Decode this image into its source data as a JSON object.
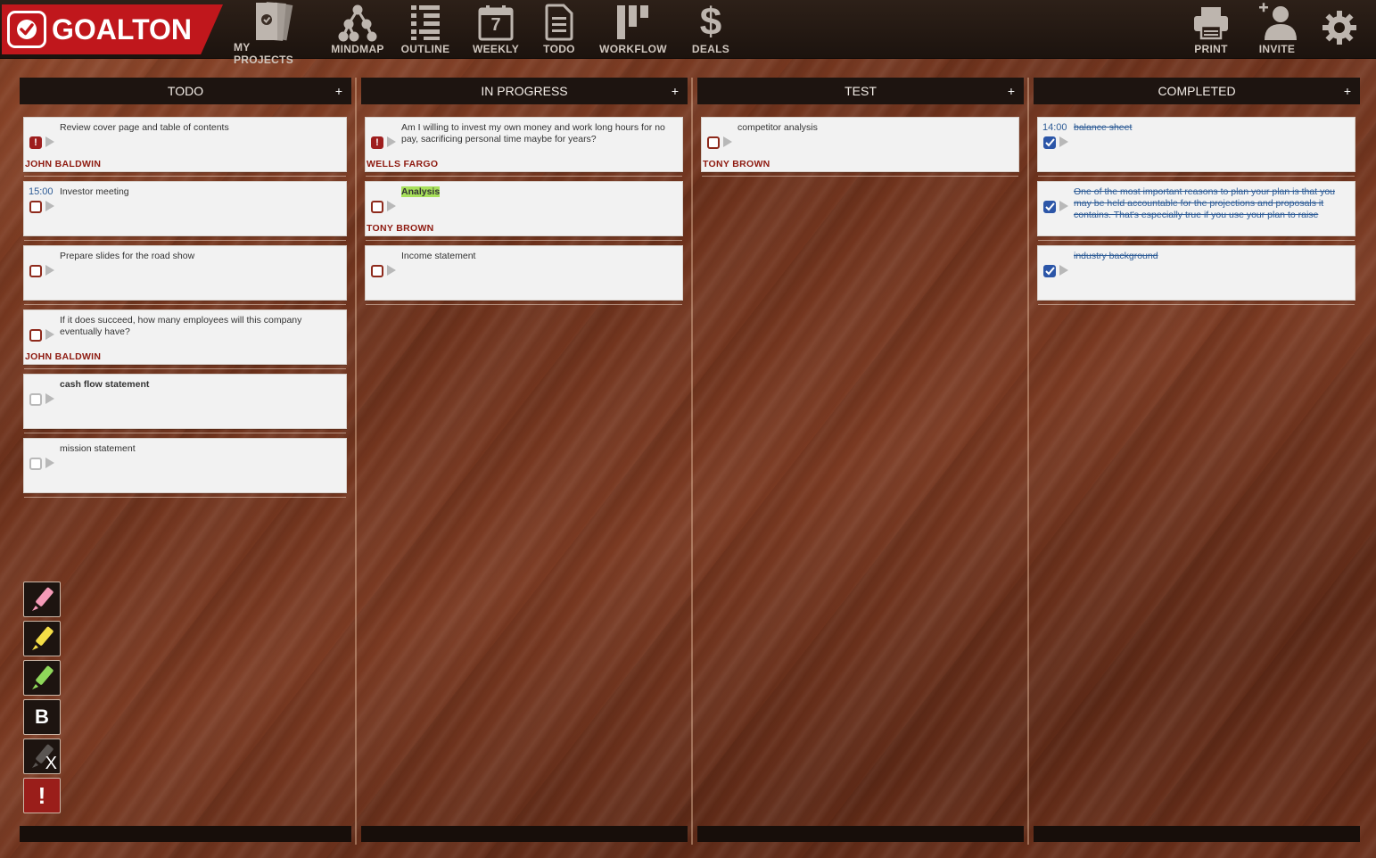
{
  "app": {
    "name": "GOALTON"
  },
  "nav": [
    {
      "label": "MY PROJECTS",
      "icon": "projects-icon"
    },
    {
      "label": "MINDMAP",
      "icon": "mindmap-icon"
    },
    {
      "label": "OUTLINE",
      "icon": "outline-icon"
    },
    {
      "label": "WEEKLY",
      "icon": "calendar-icon",
      "day": "7"
    },
    {
      "label": "TODO",
      "icon": "document-icon"
    },
    {
      "label": "WORKFLOW",
      "icon": "workflow-icon"
    },
    {
      "label": "DEALS",
      "icon": "dollar-icon",
      "symbol": "$"
    }
  ],
  "right_nav": {
    "print": "PRINT",
    "invite": "INVITE",
    "settings_icon": "gear-icon"
  },
  "columns": [
    {
      "title": "TODO",
      "add": "+",
      "cards": [
        {
          "text": "Review cover page and table of contents",
          "owner": "JOHN BALDWIN",
          "state": "urgent"
        },
        {
          "time": "15:00",
          "text": "Investor meeting",
          "state": "open"
        },
        {
          "text": "Prepare slides for the road show",
          "state": "open"
        },
        {
          "text": "If it does succeed, how many employees will this company eventually have?",
          "owner": "JOHN BALDWIN",
          "state": "open"
        },
        {
          "text": "cash flow statement",
          "state": "grey",
          "bold": true
        },
        {
          "text": "mission statement",
          "state": "grey"
        }
      ]
    },
    {
      "title": "IN PROGRESS",
      "add": "+",
      "cards": [
        {
          "text": "Am I willing to invest my own money and work long hours for no pay, sacrificing personal time maybe for years?",
          "owner": "WELLS FARGO",
          "state": "urgent"
        },
        {
          "text": "Analysis",
          "owner": "TONY BROWN",
          "state": "open",
          "highlight": true
        },
        {
          "text": "Income statement",
          "state": "open"
        }
      ]
    },
    {
      "title": "TEST",
      "add": "+",
      "cards": [
        {
          "text": "competitor analysis",
          "owner": "TONY BROWN",
          "state": "open"
        }
      ]
    },
    {
      "title": "COMPLETED",
      "add": "+",
      "cards": [
        {
          "time": "14:00",
          "text": "balance sheet",
          "state": "checked"
        },
        {
          "text": "One of the most important reasons to plan your plan is that you may be held accountable for the projections and proposals it contains. That's especially true if you use your plan to raise",
          "state": "checked"
        },
        {
          "text": "industry background",
          "state": "checked"
        }
      ]
    }
  ],
  "tools": {
    "bold": "B",
    "urgent": "!",
    "eraser": "X"
  },
  "colors": {
    "brand_red": "#c0171c",
    "owner_red": "#8e1a10",
    "done_blue": "#2e5c96",
    "highlight_green": "#a7e05a"
  }
}
